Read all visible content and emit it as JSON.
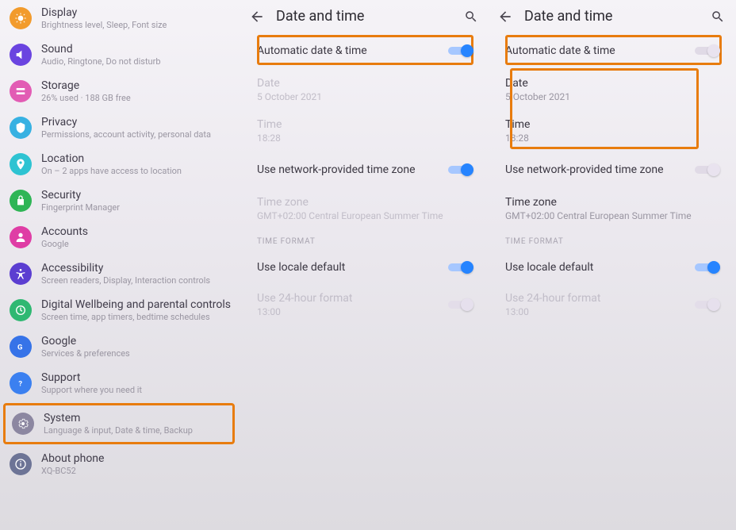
{
  "panel1": {
    "items": [
      {
        "icon": "display",
        "title": "Display",
        "sub": "Brightness level, Sleep, Font size",
        "color": "#f29b2c"
      },
      {
        "icon": "sound",
        "title": "Sound",
        "sub": "Audio, Ringtone, Do not disturb",
        "color": "#6a44e0"
      },
      {
        "icon": "storage",
        "title": "Storage",
        "sub": "26% used · 188 GB free",
        "color": "#e25cb4"
      },
      {
        "icon": "privacy",
        "title": "Privacy",
        "sub": "Permissions, account activity, personal data",
        "color": "#37b1e2"
      },
      {
        "icon": "location",
        "title": "Location",
        "sub": "On – 2 apps have access to location",
        "color": "#2ec3d2"
      },
      {
        "icon": "security",
        "title": "Security",
        "sub": "Fingerprint Manager",
        "color": "#2fb556"
      },
      {
        "icon": "accounts",
        "title": "Accounts",
        "sub": "Google",
        "color": "#df3da5"
      },
      {
        "icon": "accessibility",
        "title": "Accessibility",
        "sub": "Screen readers, Display, Interaction controls",
        "color": "#5b3ed1"
      },
      {
        "icon": "wellbeing",
        "title": "Digital Wellbeing and parental controls",
        "sub": "Screen time, app timers, bedtime schedules",
        "color": "#2fb872"
      },
      {
        "icon": "google",
        "title": "Google",
        "sub": "Services & preferences",
        "color": "#3673e8"
      },
      {
        "icon": "support",
        "title": "Support",
        "sub": "Support where you need it",
        "color": "#3b80f0"
      },
      {
        "icon": "system",
        "title": "System",
        "sub": "Language & input, Date & time, Backup",
        "color": "#8c87a1",
        "highlighted": true
      },
      {
        "icon": "about",
        "title": "About phone",
        "sub": "XQ-BC52",
        "color": "#6d7496"
      }
    ]
  },
  "panel2": {
    "header": "Date and time",
    "auto_dt": {
      "label": "Automatic date & time",
      "on": true
    },
    "date": {
      "label": "Date",
      "value": "5 October 2021"
    },
    "time": {
      "label": "Time",
      "value": "18:28"
    },
    "net_tz": {
      "label": "Use network-provided time zone",
      "on": true
    },
    "tz": {
      "label": "Time zone",
      "value": "GMT+02:00 Central European Summer Time"
    },
    "time_format": "TIME FORMAT",
    "locale_default": {
      "label": "Use locale default",
      "on": true
    },
    "h24": {
      "label": "Use 24-hour format",
      "value": "13:00"
    }
  },
  "panel3": {
    "header": "Date and time",
    "auto_dt": {
      "label": "Automatic date & time",
      "on": false
    },
    "date": {
      "label": "Date",
      "value": "5 October 2021"
    },
    "time": {
      "label": "Time",
      "value": "18:28"
    },
    "net_tz": {
      "label": "Use network-provided time zone",
      "on": false
    },
    "tz": {
      "label": "Time zone",
      "value": "GMT+02:00 Central European Summer Time"
    },
    "time_format": "TIME FORMAT",
    "locale_default": {
      "label": "Use locale default",
      "on": true
    },
    "h24": {
      "label": "Use 24-hour format",
      "value": "13:00"
    }
  }
}
